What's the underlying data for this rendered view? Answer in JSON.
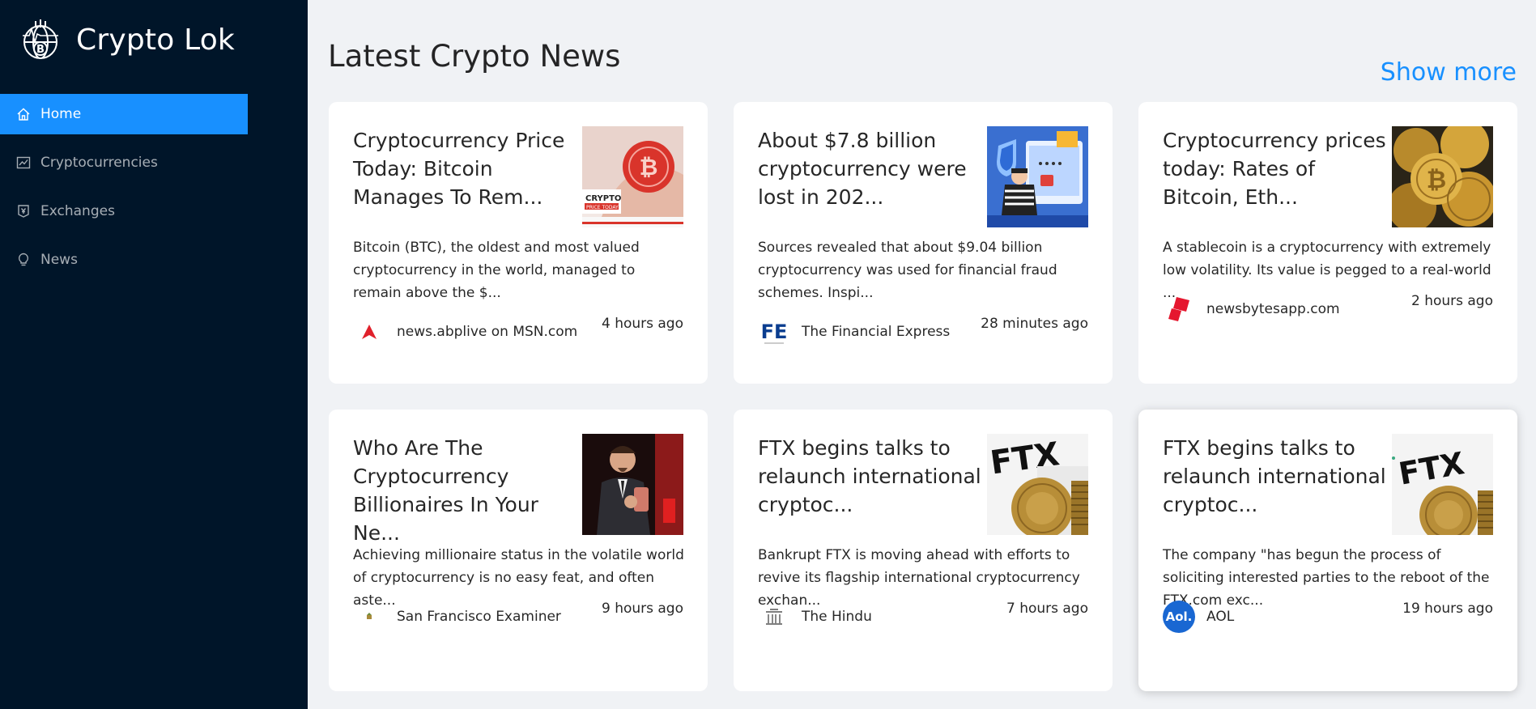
{
  "app": {
    "title": "Crypto Lok",
    "logo_icon": "bitcoin-globe-logo"
  },
  "sidebar": {
    "items": [
      {
        "label": "Home",
        "icon": "home-icon",
        "active": true
      },
      {
        "label": "Cryptocurrencies",
        "icon": "chart-icon",
        "active": false
      },
      {
        "label": "Exchanges",
        "icon": "money-collect-icon",
        "active": false
      },
      {
        "label": "News",
        "icon": "bulb-icon",
        "active": false
      }
    ]
  },
  "main": {
    "title": "Latest Crypto News",
    "show_more": "Show more"
  },
  "news": [
    {
      "title": "Cryptocurrency Price Today: Bitcoin Manages To Rem...",
      "description": "Bitcoin (BTC), the oldest and most valued cryptocurrency in the world, managed to remain above the $...",
      "provider": "news.abplive on MSN.com",
      "time": "4 hours ago",
      "thumb": "crypto-price-today-thumb"
    },
    {
      "title": "About $7.8 billion cryptocurrency were lost in 202...",
      "description": "Sources revealed that about $9.04 billion cryptocurrency was used for financial fraud schemes. Inspi...",
      "provider": "The Financial Express",
      "provider_logo_text": "FE",
      "time": "28 minutes ago",
      "thumb": "hacker-thumb"
    },
    {
      "title": "Cryptocurrency prices today: Rates of Bitcoin, Eth...",
      "description": "A stablecoin is a cryptocurrency with extremely low volatility. Its value is pegged to a real-world ...",
      "provider": "newsbytesapp.com",
      "time": "2 hours ago",
      "thumb": "gold-coins-thumb"
    },
    {
      "title": "Who Are The Cryptocurrency Billionaires In Your Ne...",
      "description": "Achieving millionaire status in the volatile world of cryptocurrency is no easy feat, and often aste...",
      "provider": "San Francisco Examiner",
      "time": "9 hours ago",
      "thumb": "businessman-thumb"
    },
    {
      "title": "FTX begins talks to relaunch international cryptoc...",
      "description": "Bankrupt FTX is moving ahead with efforts to revive its flagship international cryptocurrency exchan...",
      "provider": "The Hindu",
      "time": "7 hours ago",
      "thumb": "ftx-thumb"
    },
    {
      "title": "FTX begins talks to relaunch international cryptoc...",
      "description": "The company \"has begun the process of soliciting interested parties to the reboot of the FTX.com exc...",
      "provider": "AOL",
      "provider_logo_text": "Aol.",
      "time": "19 hours ago",
      "thumb": "ftx-thumb"
    }
  ],
  "colors": {
    "sidebar_bg": "#001529",
    "accent": "#1890ff",
    "page_bg": "#f0f2f5"
  }
}
